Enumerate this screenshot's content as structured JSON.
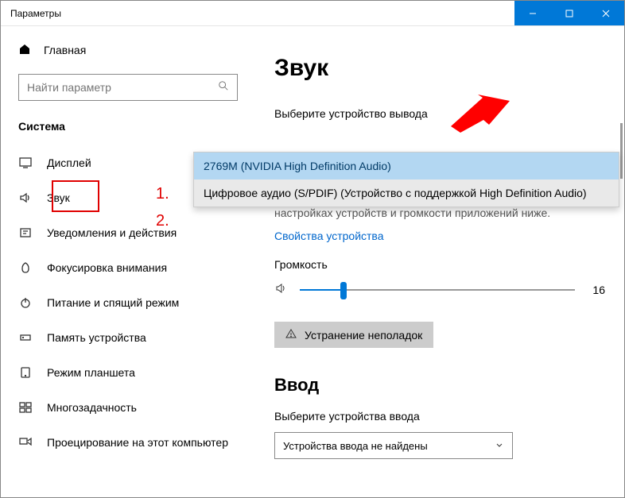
{
  "window": {
    "title": "Параметры"
  },
  "sidebar": {
    "home": "Главная",
    "search_placeholder": "Найти параметр",
    "section": "Система",
    "items": [
      {
        "label": "Дисплей"
      },
      {
        "label": "Звук"
      },
      {
        "label": "Уведомления и действия"
      },
      {
        "label": "Фокусировка внимания"
      },
      {
        "label": "Питание и спящий режим"
      },
      {
        "label": "Память устройства"
      },
      {
        "label": "Режим планшета"
      },
      {
        "label": "Многозадачность"
      },
      {
        "label": "Проецирование на этот компьютер"
      }
    ]
  },
  "annotations": {
    "one": "1.",
    "two": "2."
  },
  "main": {
    "title": "Звук",
    "output_label": "Выберите устройство вывода",
    "dropdown_options": [
      "2769M (NVIDIA High Definition Audio)",
      "Цифровое аудио (S/PDIF) (Устройство с поддержкой High Definition Audio)"
    ],
    "desc": "параметры вывода. Вы можете персонализировать их в настройках устройств и громкости приложений ниже.",
    "device_props": "Свойства устройства",
    "volume_label": "Громкость",
    "volume_value": "16",
    "troubleshoot": "Устранение неполадок",
    "input_heading": "Ввод",
    "input_label": "Выберите устройства ввода",
    "input_select": "Устройства ввода не найдены"
  }
}
